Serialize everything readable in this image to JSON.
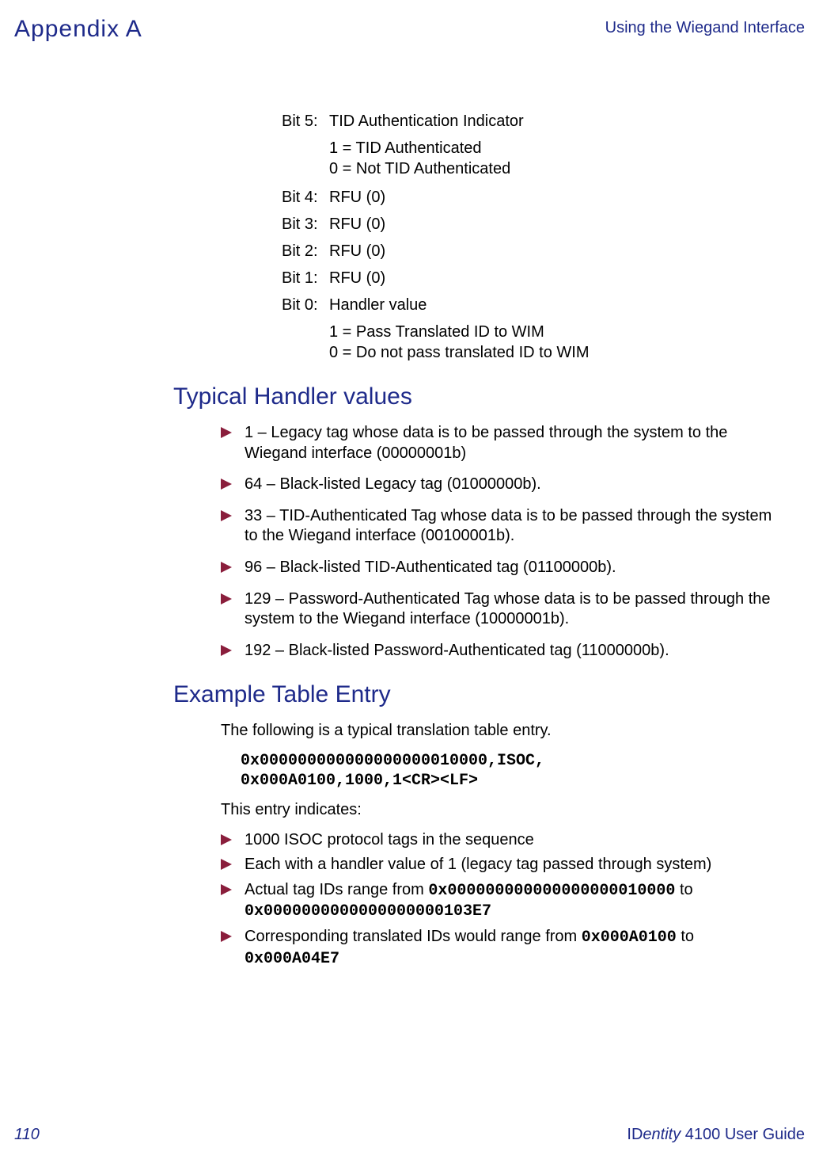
{
  "header": {
    "appendix": "Appendix A",
    "right": "Using the Wiegand Interface"
  },
  "bits": {
    "b5_label": "Bit 5:",
    "b5_value": "TID Authentication Indicator",
    "b5_sub1": "1 = TID Authenticated",
    "b5_sub2": "0 = Not TID Authenticated",
    "b4_label": "Bit 4:",
    "b4_value": "RFU (0)",
    "b3_label": "Bit 3:",
    "b3_value": "RFU (0)",
    "b2_label": "Bit 2:",
    "b2_value": "RFU (0)",
    "b1_label": "Bit 1:",
    "b1_value": "RFU (0)",
    "b0_label": "Bit 0:",
    "b0_value": "Handler value",
    "b0_sub1": "1 = Pass Translated ID to WIM",
    "b0_sub2": "0 = Do not pass translated ID to WIM"
  },
  "sect1_heading": "Typical Handler values",
  "sect1_items": {
    "i0": "1 – Legacy tag whose data is to be passed through the system to the Wiegand interface (00000001b)",
    "i1": "64 – Black-listed Legacy tag (01000000b).",
    "i2": "33 – TID-Authenticated Tag whose data is to be passed through the system to the Wiegand interface (00100001b).",
    "i3": "96 – Black-listed TID-Authenticated tag (01100000b).",
    "i4": "129 – Password-Authenticated Tag whose data is to be passed through the system to the Wiegand interface (10000001b).",
    "i5": "192 – Black-listed Password-Authenticated tag (11000000b)."
  },
  "sect2_heading": "Example Table Entry",
  "sect2_intro": "The following is a typical translation table entry.",
  "sect2_code1": "0x000000000000000000010000,ISOC,",
  "sect2_code2": "0x000A0100,1000,1<CR><LF>",
  "sect2_after": "This entry indicates:",
  "sect2_items": {
    "i0": "1000 ISOC protocol tags in the sequence",
    "i1": "Each with a handler value of 1 (legacy tag passed through system)",
    "i2_a": "Actual tag IDs range from ",
    "i2_b": "0x000000000000000000010000",
    "i2_c": " to ",
    "i2_d": "0x0000000000000000000103E7",
    "i3_a": "Corresponding translated IDs would range from ",
    "i3_b": "0x000A0100",
    "i3_c": " to ",
    "i3_d": "0x000A04E7"
  },
  "footer": {
    "page": "110",
    "guide_pre": "ID",
    "guide_ital": "entity",
    "guide_post": " 4100 User Guide"
  }
}
